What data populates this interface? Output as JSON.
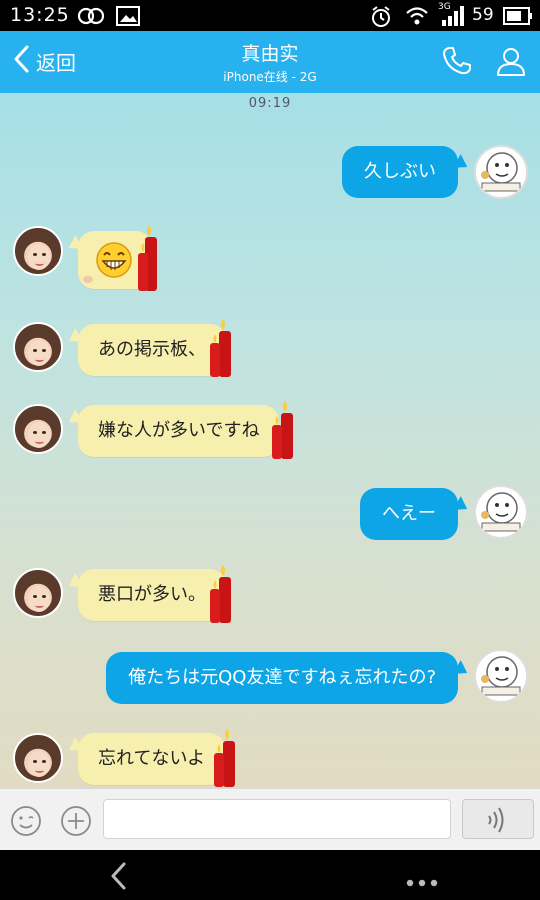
{
  "status_bar": {
    "time": "13:25",
    "battery_percent": "59",
    "network": "3G",
    "icons": [
      "link-icon",
      "image-icon",
      "alarm-icon",
      "wifi-icon",
      "signal-icon",
      "battery-icon"
    ]
  },
  "header": {
    "back_label": "返回",
    "title": "真由实",
    "subtitle": "iPhone在线 - 2G",
    "icons": [
      "phone-icon",
      "profile-icon"
    ]
  },
  "chat": {
    "timestamp": "09:19",
    "messages": [
      {
        "side": "out",
        "text": "久しぶい"
      },
      {
        "side": "in",
        "text": "",
        "emoji": "grin-emoji-icon"
      },
      {
        "side": "in",
        "text": "あの掲示板、"
      },
      {
        "side": "in",
        "text": "嫌な人が多いですね"
      },
      {
        "side": "out",
        "text": "へえー"
      },
      {
        "side": "in",
        "text": "悪口が多い。"
      },
      {
        "side": "out",
        "text": "俺たちは元QQ友達ですねぇ忘れたの?"
      },
      {
        "side": "in",
        "text": "忘れてないよ"
      }
    ]
  },
  "input_bar": {
    "placeholder": "",
    "value": ""
  },
  "colors": {
    "header": "#27b1ee",
    "bubble_out": "#0ea5e6",
    "bubble_in": "#f7efae"
  }
}
